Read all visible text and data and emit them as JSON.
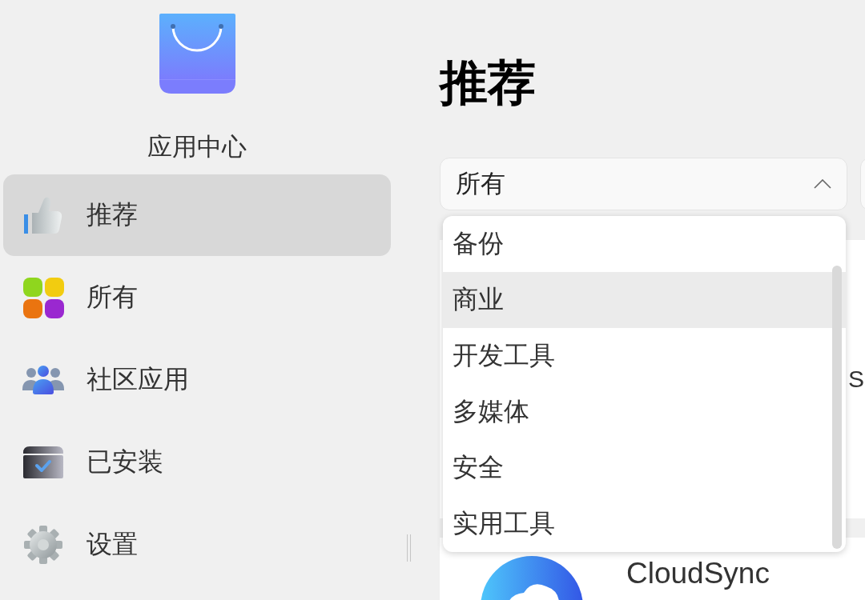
{
  "sidebar": {
    "app_name": "应用中心",
    "items": [
      {
        "label": "推荐",
        "kind": "recommended",
        "selected": true
      },
      {
        "label": "所有",
        "kind": "all",
        "selected": false
      },
      {
        "label": "社区应用",
        "kind": "community",
        "selected": false
      },
      {
        "label": "已安装",
        "kind": "installed",
        "selected": false
      },
      {
        "label": "设置",
        "kind": "settings",
        "selected": false
      }
    ]
  },
  "main": {
    "title": "推荐",
    "category_filter": {
      "value": "所有",
      "expanded": true,
      "options": [
        {
          "label": "备份",
          "highlighted": false
        },
        {
          "label": "商业",
          "highlighted": true
        },
        {
          "label": "开发工具",
          "highlighted": false
        },
        {
          "label": "多媒体",
          "highlighted": false
        },
        {
          "label": "安全",
          "highlighted": false
        },
        {
          "label": "实用工具",
          "highlighted": false
        }
      ]
    },
    "upper_card": {
      "text": "S"
    },
    "app_card": {
      "name": "CloudSync"
    }
  }
}
